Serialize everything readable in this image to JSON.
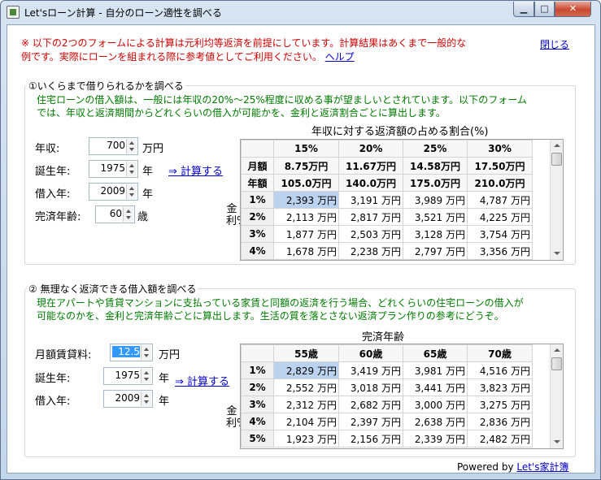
{
  "window": {
    "title": "Let'sローン計算 - 自分のローン適性を調べる",
    "min_glyph": "▁",
    "max_glyph": "□",
    "close_glyph": "✕"
  },
  "notice": {
    "line1": "※ 以下の2つのフォームによる計算は元利均等返済を前提にしています。計算結果はあくまで一般的な",
    "line2": "例です。実際にローンを組まれる際に参考値としてご利用ください。",
    "help_link": "ヘルプ",
    "close_link": "閉じる"
  },
  "section1": {
    "legend": "①いくらまで借りられるかを調べる",
    "desc_line1": "住宅ローンの借入額は、一般には年収の20%～25%程度に収める事が望ましいとされています。以下のフォーム",
    "desc_line2": "では、年収と返済期間からどれくらいの借入が可能かを、金利と返済割合ごとに算出します。",
    "fields": [
      {
        "label": "年収:",
        "value": "700",
        "unit": "万円"
      },
      {
        "label": "誕生年:",
        "value": "1975",
        "unit": "年"
      },
      {
        "label": "借入年:",
        "value": "2009",
        "unit": "年"
      },
      {
        "label": "完済年齢:",
        "value": "60",
        "unit": "歳"
      }
    ],
    "calc_link": "⇒ 計算する",
    "grid_caption": "年収に対する返済額の占める割合(%)",
    "row_axis_label": "金利%",
    "headers": [
      "15%",
      "20%",
      "25%",
      "30%"
    ],
    "summary_rows": [
      {
        "label": "月額",
        "cells": [
          "8.75万円",
          "11.67万円",
          "14.58万円",
          "17.50万円"
        ]
      },
      {
        "label": "年額",
        "cells": [
          "105.0万円",
          "140.0万円",
          "175.0万円",
          "210.0万円"
        ]
      }
    ],
    "rows": [
      {
        "label": "1%",
        "cells": [
          "2,393 万円",
          "3,191 万円",
          "3,989 万円",
          "4,787 万円"
        ]
      },
      {
        "label": "2%",
        "cells": [
          "2,113 万円",
          "2,817 万円",
          "3,521 万円",
          "4,225 万円"
        ]
      },
      {
        "label": "3%",
        "cells": [
          "1,877 万円",
          "2,503 万円",
          "3,128 万円",
          "3,754 万円"
        ]
      },
      {
        "label": "4%",
        "cells": [
          "1,678 万円",
          "2,238 万円",
          "2,797 万円",
          "3,356 万円"
        ]
      }
    ]
  },
  "section2": {
    "legend": "② 無理なく返済できる借入額を調べる",
    "desc_line1": "現在アパートや賃貸マンションに支払っている家賃と同額の返済を行う場合、どれくらいの住宅ローンの借入が",
    "desc_line2": "可能なのかを、金利と完済年齢ごとに算出します。生活の質を落とさない返済プラン作りの参考にどうぞ。",
    "fields": [
      {
        "label": "月額賃貸料:",
        "value": "12.5",
        "unit": "万円"
      },
      {
        "label": "誕生年:",
        "value": "1975",
        "unit": "年"
      },
      {
        "label": "借入年:",
        "value": "2009",
        "unit": "年"
      }
    ],
    "calc_link": "⇒ 計算する",
    "grid_caption": "完済年齢",
    "row_axis_label": "金利%",
    "headers": [
      "55歳",
      "60歳",
      "65歳",
      "70歳"
    ],
    "rows": [
      {
        "label": "1%",
        "cells": [
          "2,829 万円",
          "3,419 万円",
          "3,981 万円",
          "4,516 万円"
        ]
      },
      {
        "label": "2%",
        "cells": [
          "2,552 万円",
          "3,018 万円",
          "3,441 万円",
          "3,823 万円"
        ]
      },
      {
        "label": "3%",
        "cells": [
          "2,312 万円",
          "2,682 万円",
          "3,000 万円",
          "3,275 万円"
        ]
      },
      {
        "label": "4%",
        "cells": [
          "2,104 万円",
          "2,397 万円",
          "2,638 万円",
          "2,836 万円"
        ]
      },
      {
        "label": "5%",
        "cells": [
          "1,923 万円",
          "2,156 万円",
          "2,339 万円",
          "2,482 万円"
        ]
      }
    ]
  },
  "footer": {
    "powered_by": "Powered by",
    "link": "Let's家計簿"
  }
}
